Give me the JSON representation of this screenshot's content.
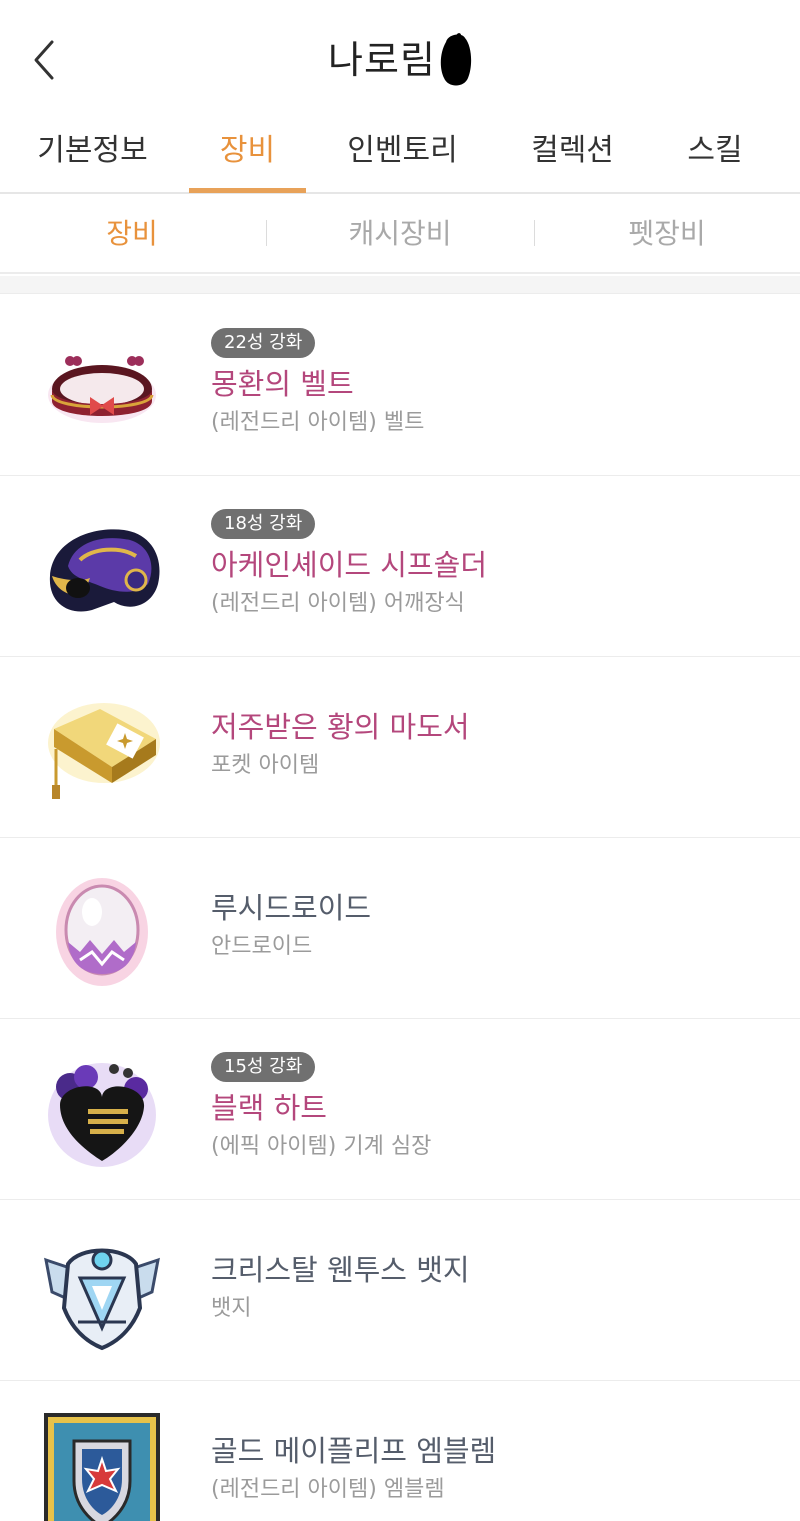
{
  "header": {
    "title": "나로림",
    "back_icon": "chevron-left-icon"
  },
  "tabs": [
    {
      "label": "기본정보",
      "active": false
    },
    {
      "label": "장비",
      "active": true
    },
    {
      "label": "인벤토리",
      "active": false
    },
    {
      "label": "컬렉션",
      "active": false
    },
    {
      "label": "스킬",
      "active": false
    }
  ],
  "subtabs": [
    {
      "label": "장비",
      "active": true
    },
    {
      "label": "캐시장비",
      "active": false
    },
    {
      "label": "펫장비",
      "active": false
    }
  ],
  "colors": {
    "accent": "#e8923c",
    "item_name_rarity": "#b4477c",
    "item_name_normal": "#555d6b",
    "badge_bg": "#707070"
  },
  "items": [
    {
      "badge": "22성 강화",
      "name": "몽환의 벨트",
      "desc": "(레전드리 아이템) 벨트",
      "icon": "belt-icon"
    },
    {
      "badge": "18성 강화",
      "name": "아케인셰이드 시프숄더",
      "desc": "(레전드리 아이템) 어깨장식",
      "icon": "shoulder-icon"
    },
    {
      "badge": "",
      "name": "저주받은 황의 마도서",
      "desc": "포켓 아이템",
      "icon": "grimoire-icon"
    },
    {
      "badge": "",
      "name": "루시드로이드",
      "desc": "안드로이드",
      "icon": "egg-icon"
    },
    {
      "badge": "15성 강화",
      "name": "블랙 하트",
      "desc": "(에픽 아이템) 기계 심장",
      "icon": "black-heart-icon"
    },
    {
      "badge": "",
      "name": "크리스탈 웬투스 뱃지",
      "desc": "뱃지",
      "icon": "crystal-badge-icon"
    },
    {
      "badge": "",
      "name": "골드 메이플리프 엠블렘",
      "desc": "(레전드리 아이템) 엠블렘",
      "icon": "emblem-icon"
    }
  ]
}
